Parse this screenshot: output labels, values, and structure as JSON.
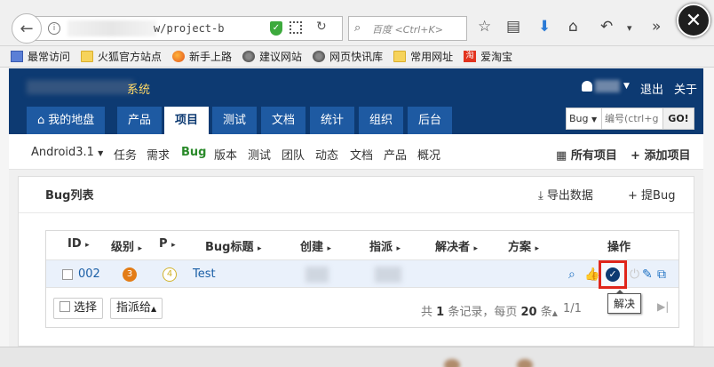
{
  "browser": {
    "url": "w/project-b",
    "search_placeholder": "百度 <Ctrl+K>",
    "bookmarks": [
      "最常访问",
      "火狐官方站点",
      "新手上路",
      "建议网站",
      "网页快讯库",
      "常用网址",
      "爱淘宝"
    ]
  },
  "header": {
    "brand_suffix": "系统",
    "logout": "退出",
    "about": "关于",
    "nav": [
      "我的地盘",
      "产品",
      "项目",
      "测试",
      "文档",
      "统计",
      "组织",
      "后台"
    ],
    "search_type": "Bug",
    "search_placeholder": "编号(ctrl+g",
    "go": "GO!"
  },
  "subnav": {
    "project": "Android3.1",
    "items": [
      "任务",
      "需求",
      "Bug",
      "版本",
      "测试",
      "团队",
      "动态",
      "文档",
      "产品",
      "概况"
    ],
    "all_projects": "所有项目",
    "add_project": "添加项目"
  },
  "panel": {
    "title": "Bug列表",
    "export": "导出数据",
    "report": "提Bug"
  },
  "table": {
    "headers": [
      "ID",
      "级别",
      "P",
      "Bug标题",
      "创建",
      "指派",
      "解决者",
      "方案",
      "操作"
    ],
    "rows": [
      {
        "id": "002",
        "severity": "3",
        "pri": "4",
        "title": "Test"
      }
    ]
  },
  "footer": {
    "select": "选择",
    "assign": "指派给",
    "summary_prefix": "共",
    "summary_count": "1",
    "summary_mid": "条记录，每页",
    "per_page": "20",
    "summary_suffix": "条",
    "page": "1/1"
  },
  "tooltip": "解决"
}
